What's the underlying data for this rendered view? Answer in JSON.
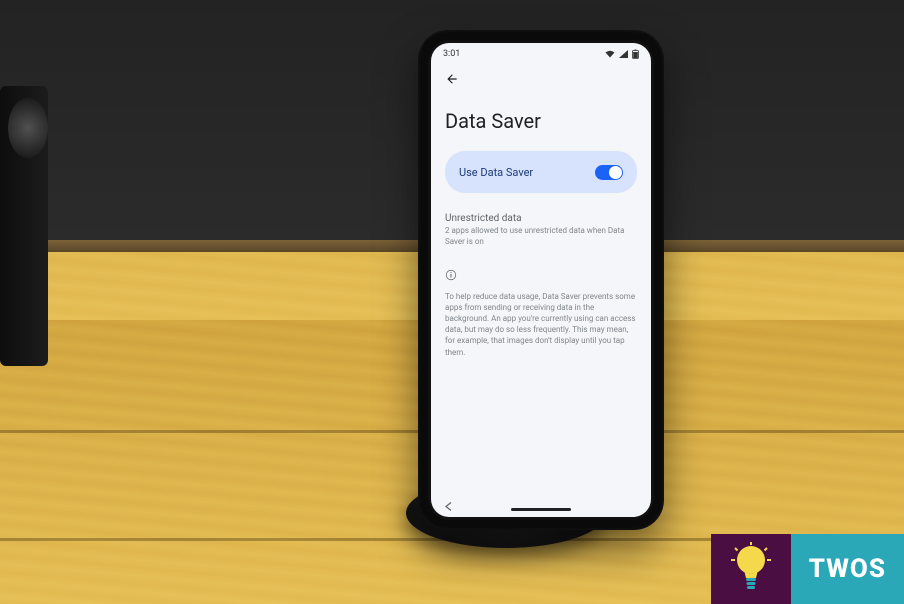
{
  "status_bar": {
    "time": "3:01"
  },
  "app_bar": {
    "back_label": "Back"
  },
  "page": {
    "title": "Data Saver"
  },
  "toggle": {
    "label": "Use Data Saver",
    "state": "on"
  },
  "unrestricted": {
    "title": "Unrestricted data",
    "subtitle": "2 apps allowed to use unrestricted data when Data Saver is on"
  },
  "info": {
    "text": "To help reduce data usage, Data Saver prevents some apps from sending or receiving data in the background. An app you're currently using can access data, but may do so less frequently. This may mean, for example, that images don't display until you tap them."
  },
  "watermark": {
    "text": "TWOS",
    "icon_color": "#4b0e43",
    "box_color": "#2aa8b8"
  }
}
